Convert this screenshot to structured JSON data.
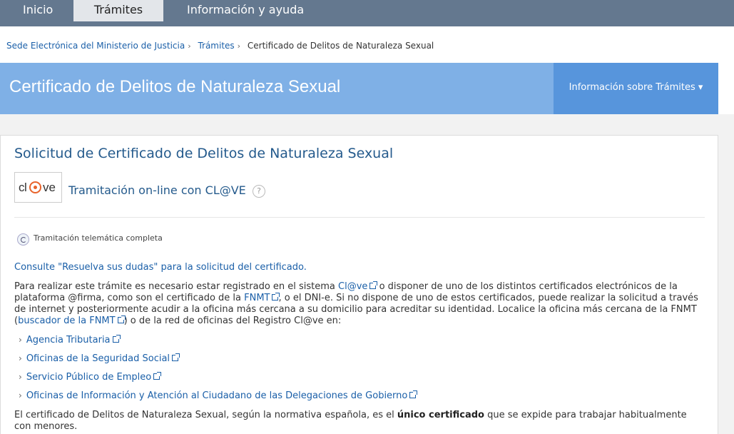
{
  "nav": {
    "tabs": [
      {
        "label": "Inicio"
      },
      {
        "label": "Trámites"
      },
      {
        "label": "Información y ayuda"
      }
    ]
  },
  "breadcrumb": {
    "items": [
      "Sede Electrónica del Ministerio de Justicia",
      "Trámites",
      "Certificado de Delitos de Naturaleza Sexual"
    ],
    "separator": "›"
  },
  "header": {
    "title": "Certificado de Delitos de Naturaleza Sexual",
    "info_button": "Información sobre Trámites ▾"
  },
  "card": {
    "title": "Solicitud de Certificado de Delitos de Naturaleza Sexual",
    "logo": {
      "part1": "cl",
      "part2": "ve"
    },
    "clave_label": "Tramitación on-line con CL@VE",
    "help_glyph": "?",
    "tele_label": "Tramitación telemática completa",
    "consulte": "Consulte \"Resuelva sus dudas\" para la solicitud del certificado.",
    "p1": {
      "t1": "Para realizar este trámite es necesario estar registrado en el sistema ",
      "l1": "Cl@ve",
      "t2": " o disponer de uno de los distintos certificados electrónicos de la plataforma @firma, como son el certificado de la ",
      "l2": "FNMT",
      "t3": ", o el DNI-e. Si no dispone de uno de estos certificados, puede realizar la solicitud a través de internet y posteriormente acudir a la oficina más cercana a su domicilio para acreditar su identidad. Localice la oficina más cercana de la FNMT (",
      "l3": "buscador de la FNMT",
      "t4": ") o de la red de oficinas del Registro Cl@ve en:"
    },
    "links": [
      "Agencia Tributaria",
      "Oficinas de la Seguridad Social",
      "Servicio Público de Empleo",
      "Oficinas de Información y Atención al Ciudadano de las Delegaciones de Gobierno"
    ],
    "p2": {
      "t1": "El certificado de Delitos de Naturaleza Sexual, según la normativa española, es el ",
      "b1": "único certificado",
      "t2": " que se expide para trabajar habitualmente con menores."
    }
  },
  "colors": {
    "nav_bg": "#64788f",
    "header_band": "#7fb0e6",
    "info_button": "#5795dc",
    "link": "#1a5fa8",
    "title": "#245a8c"
  }
}
